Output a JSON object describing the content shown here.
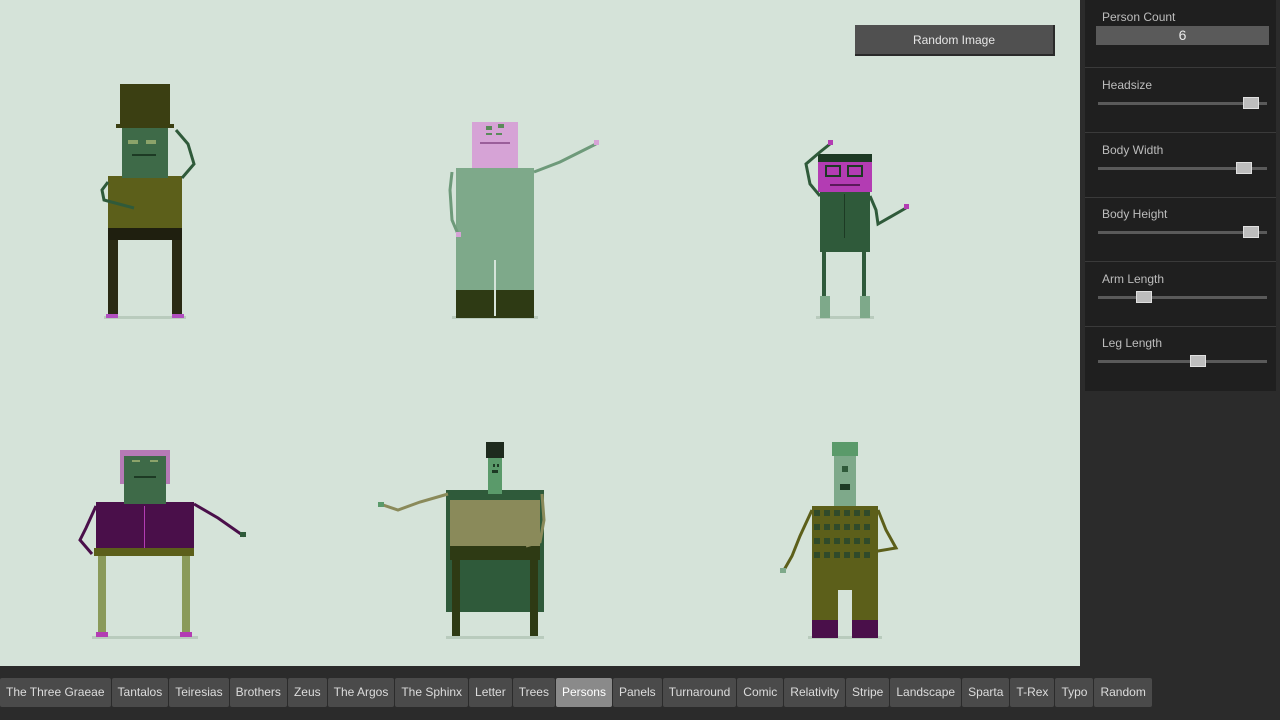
{
  "canvas": {
    "background": "#d5e3d9",
    "random_button_label": "Random Image"
  },
  "controls": {
    "person_count": {
      "label": "Person Count",
      "value": "6"
    },
    "sliders": [
      {
        "label": "Headsize",
        "value": 0.95
      },
      {
        "label": "Body Width",
        "value": 0.9
      },
      {
        "label": "Body Height",
        "value": 0.95
      },
      {
        "label": "Arm Length",
        "value": 0.25
      },
      {
        "label": "Leg Length",
        "value": 0.6
      }
    ]
  },
  "tabs": {
    "items": [
      "The Three Graeae",
      "Tantalos",
      "Teiresias",
      "Brothers",
      "Zeus",
      "The Argos",
      "The Sphinx",
      "Letter",
      "Trees",
      "Persons",
      "Panels",
      "Turnaround",
      "Comic",
      "Relativity",
      "Stripe",
      "Landscape",
      "Sparta",
      "T-Rex",
      "Typo",
      "Random"
    ],
    "active": "Persons"
  },
  "colors": {
    "panel_bg": "#1f1f1f",
    "tab_bg": "#4a4a4a",
    "tab_active": "#8a8a8a"
  }
}
